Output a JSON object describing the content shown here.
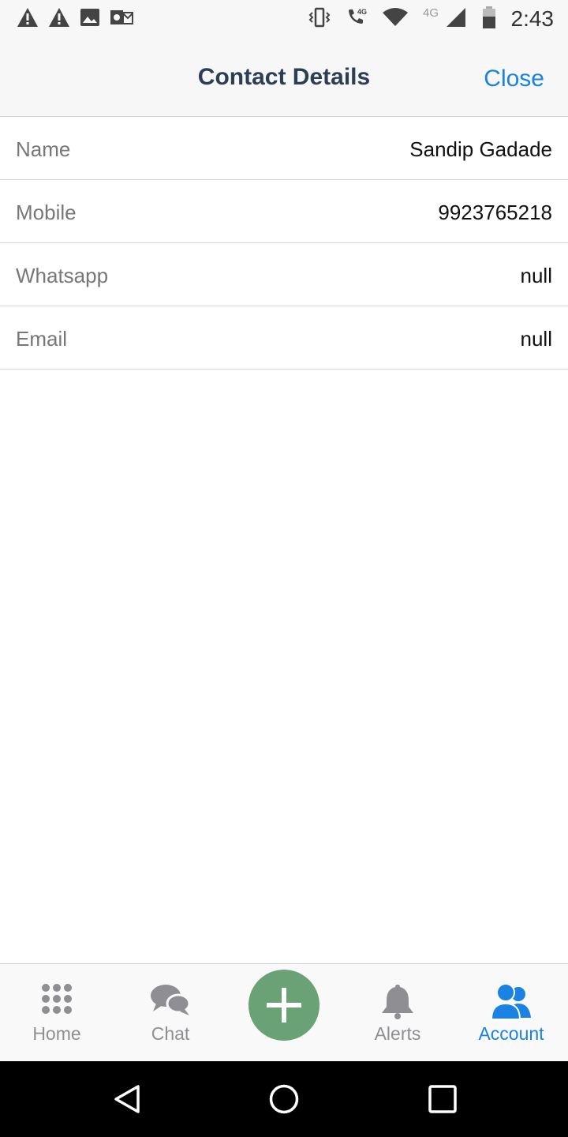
{
  "status_bar": {
    "time": "2:43",
    "network_label": "4G",
    "call_badge": "4G",
    "icons_left": [
      "warning-icon",
      "warning-icon",
      "image-icon",
      "outlook-icon"
    ],
    "icons_right": [
      "vibrate-icon",
      "volte-call-icon",
      "wifi-icon",
      "signal-icon",
      "battery-icon"
    ]
  },
  "header": {
    "title": "Contact Details",
    "close_label": "Close"
  },
  "details": [
    {
      "label": "Name",
      "value": "Sandip Gadade"
    },
    {
      "label": "Mobile",
      "value": "9923765218"
    },
    {
      "label": "Whatsapp",
      "value": "null"
    },
    {
      "label": "Email",
      "value": "null"
    }
  ],
  "tabs": [
    {
      "label": "Home",
      "icon": "grid-dots-icon",
      "active": false
    },
    {
      "label": "Chat",
      "icon": "chat-bubbles-icon",
      "active": false
    },
    {
      "label": "Alerts",
      "icon": "bell-icon",
      "active": false
    },
    {
      "label": "Account",
      "icon": "users-icon",
      "active": true
    }
  ],
  "fab": {
    "icon": "plus-icon"
  },
  "colors": {
    "accent": "#1a82e2",
    "title": "#2c3e55",
    "fab": "#6aa276",
    "inactive_tab": "#8e8e93"
  },
  "nav_bar": {
    "icons": [
      "back-icon",
      "home-circle-icon",
      "recents-icon"
    ]
  }
}
